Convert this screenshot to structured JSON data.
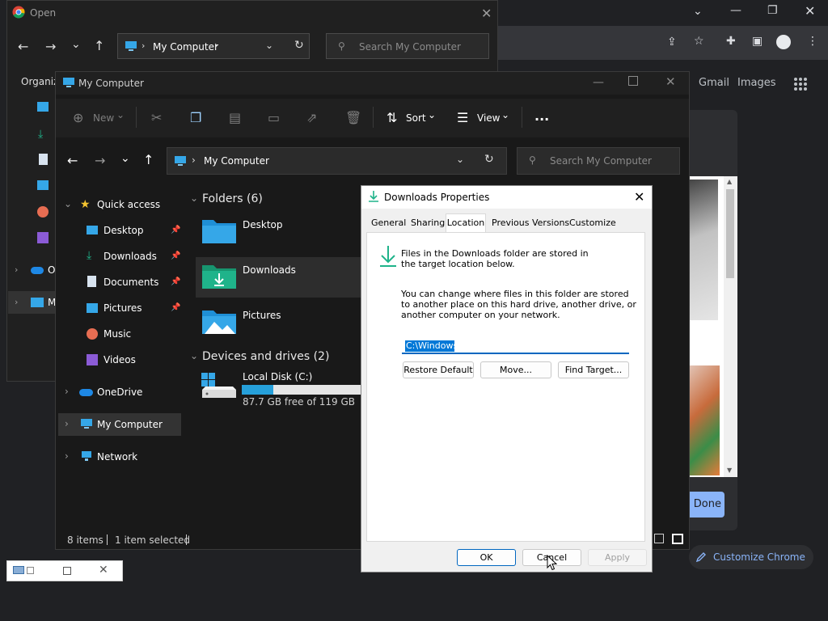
{
  "chrome": {
    "gmail": "Gmail",
    "images": "Images",
    "done": "Done",
    "customize": "Customize Chrome"
  },
  "open_dialog": {
    "title": "Open",
    "address": "My Computer",
    "search_placeholder": "Search My Computer",
    "organize": "Organize",
    "nav_partials": [
      "O",
      "M"
    ]
  },
  "explorer": {
    "title": "My Computer",
    "toolbar": {
      "new": "New",
      "sort": "Sort",
      "view": "View",
      "more": "..."
    },
    "address": "My Computer",
    "search_placeholder": "Search My Computer",
    "nav": {
      "quick_access": "Quick access",
      "items": [
        {
          "label": "Desktop",
          "icon": "desktop-icon",
          "pinned": true
        },
        {
          "label": "Downloads",
          "icon": "downloads-icon",
          "pinned": true
        },
        {
          "label": "Documents",
          "icon": "documents-icon",
          "pinned": true
        },
        {
          "label": "Pictures",
          "icon": "pictures-icon",
          "pinned": true
        },
        {
          "label": "Music",
          "icon": "music-icon",
          "pinned": false
        },
        {
          "label": "Videos",
          "icon": "videos-icon",
          "pinned": false
        }
      ],
      "onedrive": "OneDrive",
      "my_computer": "My Computer",
      "network": "Network"
    },
    "folders_header": "Folders (6)",
    "folders": [
      "Desktop",
      "Downloads",
      "Pictures"
    ],
    "devices_header": "Devices and drives (2)",
    "drive": {
      "name": "Local Disk (C:)",
      "free_text": "87.7 GB free of 119 GB",
      "used_fraction": 0.263
    },
    "status": {
      "items": "8 items",
      "selected": "1 item selected"
    }
  },
  "props": {
    "title": "Downloads Properties",
    "tabs": [
      "General",
      "Sharing",
      "Location",
      "Previous Versions",
      "Customize"
    ],
    "active_tab": "Location",
    "info1": "Files in the Downloads folder are stored in the target location below.",
    "info2": "You can change where files in this folder are stored to another place on this hard drive, another drive, or another computer on your network.",
    "path": "C:\\Windows",
    "buttons": {
      "restore": "Restore Default",
      "move": "Move...",
      "find": "Find Target..."
    },
    "footer": {
      "ok": "OK",
      "cancel": "Cancel",
      "apply": "Apply"
    }
  },
  "colors": {
    "accent": "#0078d7",
    "folder_blue": "#35a7e8",
    "downloads_green": "#1fb38a",
    "chrome_blue": "#8ab4f8"
  }
}
